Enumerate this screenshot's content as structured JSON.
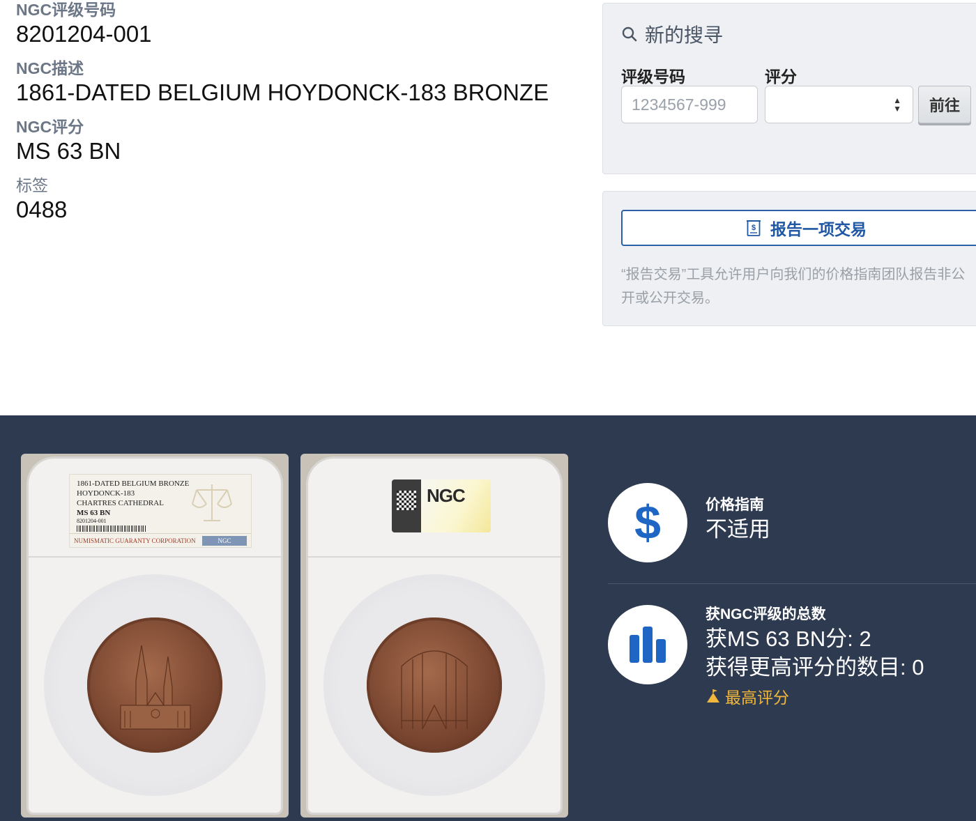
{
  "details": {
    "cert_label": "NGC评级号码",
    "cert_value": "8201204-001",
    "desc_label": "NGC描述",
    "desc_value": "1861-DATED BELGIUM HOYDONCK-183 BRONZE",
    "grade_label": "NGC评分",
    "grade_value": "MS 63 BN",
    "tag_label": "标签",
    "tag_value": "0488"
  },
  "search": {
    "title": "新的搜寻",
    "cert_label": "评级号码",
    "cert_placeholder": "1234567-999",
    "grade_label": "评分",
    "grade_selected": "",
    "go_label": "前往"
  },
  "report": {
    "button_label": "报告一项交易",
    "description_line1": "“报告交易”工具允许用户向我们的价格指南团队报告非公",
    "description_line2": "开或公开交易。"
  },
  "slab_front_label": {
    "line1": "1861-DATED BELGIUM BRONZE",
    "line2": "HOYDONCK-183",
    "line3": "CHARTRES CATHEDRAL",
    "line4": "MS 63 BN",
    "line5": "8201204-001",
    "footer": "NUMISMATIC GUARANTY CORPORATION",
    "logo": "NGC"
  },
  "slab_back_label": {
    "logo": "NGC"
  },
  "price_guide": {
    "label": "价格指南",
    "value": "不适用",
    "icon": "dollar-icon"
  },
  "population": {
    "label": "获NGC评级的总数",
    "at_grade": "获MS 63 BN分: 2",
    "higher": "获得更高评分的数目: 0",
    "top_pop_label": "最高评分",
    "icon": "bar-chart-icon"
  },
  "colors": {
    "dark_bg": "#2e3a50",
    "accent_blue": "#1f57a4",
    "top_pop": "#f0b73c"
  }
}
